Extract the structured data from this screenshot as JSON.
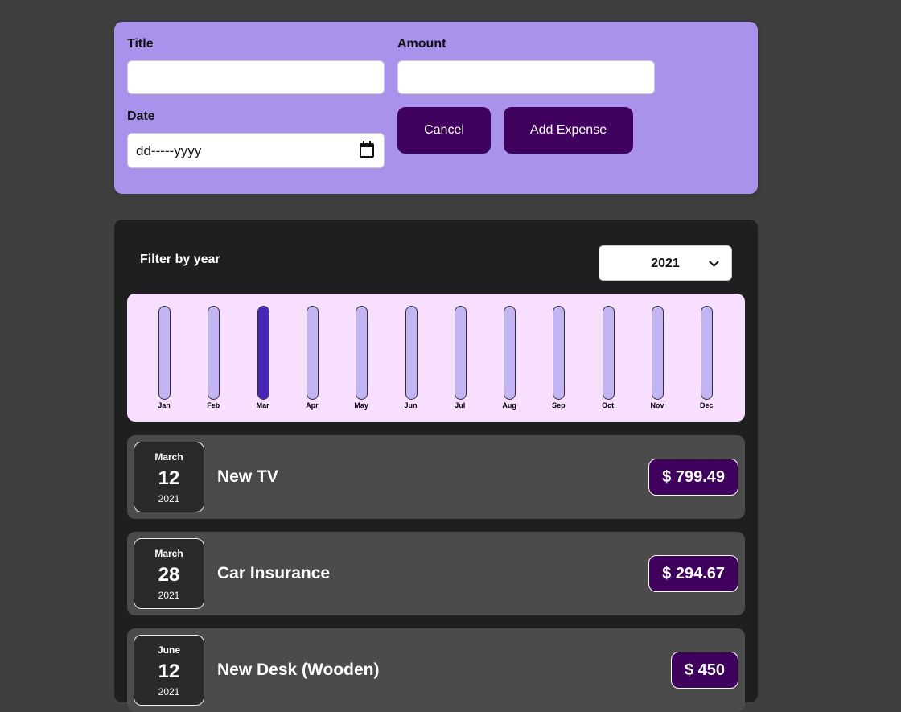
{
  "form": {
    "title_label": "Title",
    "amount_label": "Amount",
    "date_label": "Date",
    "title_value": "",
    "amount_value": "",
    "date_placeholder": "dd-----yyyy",
    "cancel_label": "Cancel",
    "add_label": "Add Expense"
  },
  "filter": {
    "label": "Filter by year",
    "selected_year": "2021"
  },
  "chart_data": {
    "type": "bar",
    "categories": [
      "Jan",
      "Feb",
      "Mar",
      "Apr",
      "May",
      "Jun",
      "Jul",
      "Aug",
      "Sep",
      "Oct",
      "Nov",
      "Dec"
    ],
    "values": [
      0,
      0,
      1094.16,
      0,
      0,
      0,
      0,
      0,
      0,
      0,
      0,
      0
    ],
    "ylim": [
      0,
      1094.16
    ],
    "title": "",
    "xlabel": "",
    "ylabel": "",
    "grid": false,
    "colors": {
      "background": "#f8dfff",
      "track": "#c3b4f3",
      "fill": "#4826b9"
    }
  },
  "expenses": [
    {
      "month": "March",
      "day": "12",
      "year": "2021",
      "title": "New TV",
      "price": "$ 799.49"
    },
    {
      "month": "March",
      "day": "28",
      "year": "2021",
      "title": "Car Insurance",
      "price": "$ 294.67"
    },
    {
      "month": "June",
      "day": "12",
      "year": "2021",
      "title": "New Desk (Wooden)",
      "price": "$ 450"
    }
  ],
  "colors": {
    "page_background": "#3f3f3f",
    "form_background": "#a892ec",
    "button_background": "#40005d",
    "list_background": "#1f1f1f",
    "item_background": "#4b4b4b"
  }
}
